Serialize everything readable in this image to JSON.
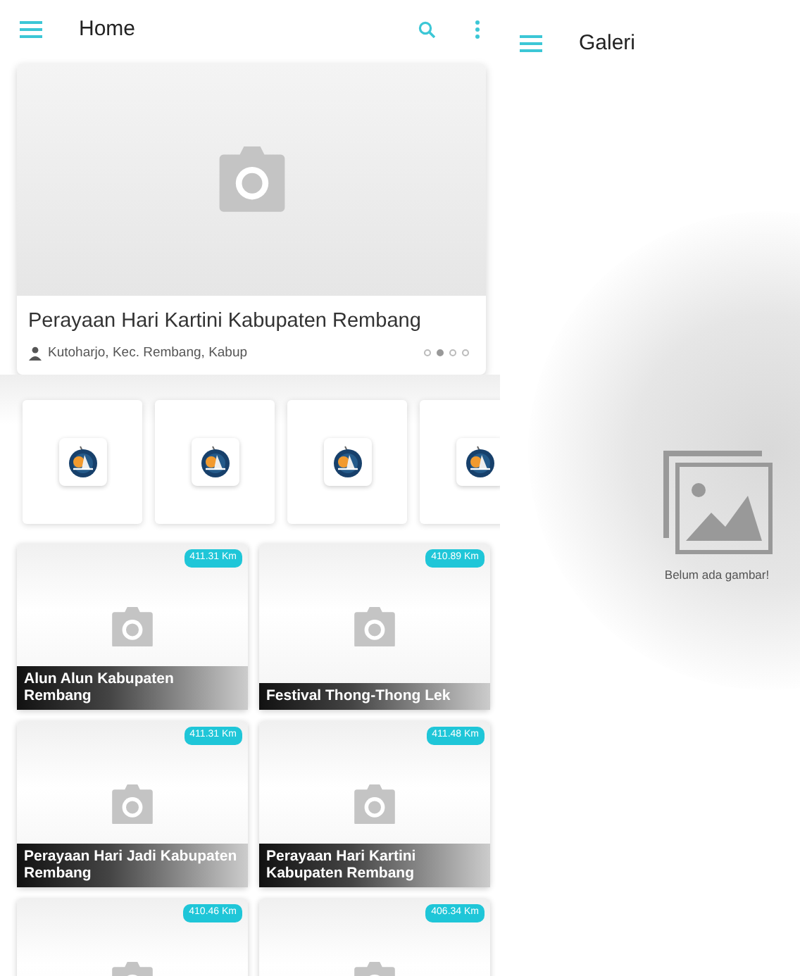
{
  "home": {
    "title": "Home",
    "featured": {
      "title": "Perayaan Hari Kartini Kabupaten Rembang",
      "location": "Kutoharjo, Kec. Rembang, Kabup",
      "slides": [
        {
          "selected": false
        },
        {
          "selected": true
        },
        {
          "selected": false
        },
        {
          "selected": false
        }
      ]
    },
    "categories": [
      {
        "kind": "logo"
      },
      {
        "kind": "logo"
      },
      {
        "kind": "logo"
      },
      {
        "kind": "logo"
      }
    ],
    "places": [
      {
        "distance": "411.31 Km",
        "title": "Alun Alun Kabupaten Rembang"
      },
      {
        "distance": "410.89 Km",
        "title": "Festival Thong-Thong Lek"
      },
      {
        "distance": "411.31 Km",
        "title": "Perayaan Hari Jadi Kabupaten Rembang"
      },
      {
        "distance": "411.48 Km",
        "title": "Perayaan Hari Kartini Kabupaten Rembang"
      },
      {
        "distance": "410.46 Km"
      },
      {
        "distance": "406.34 Km"
      }
    ]
  },
  "gallery": {
    "title": "Galeri",
    "empty_message": "Belum ada gambar!"
  }
}
